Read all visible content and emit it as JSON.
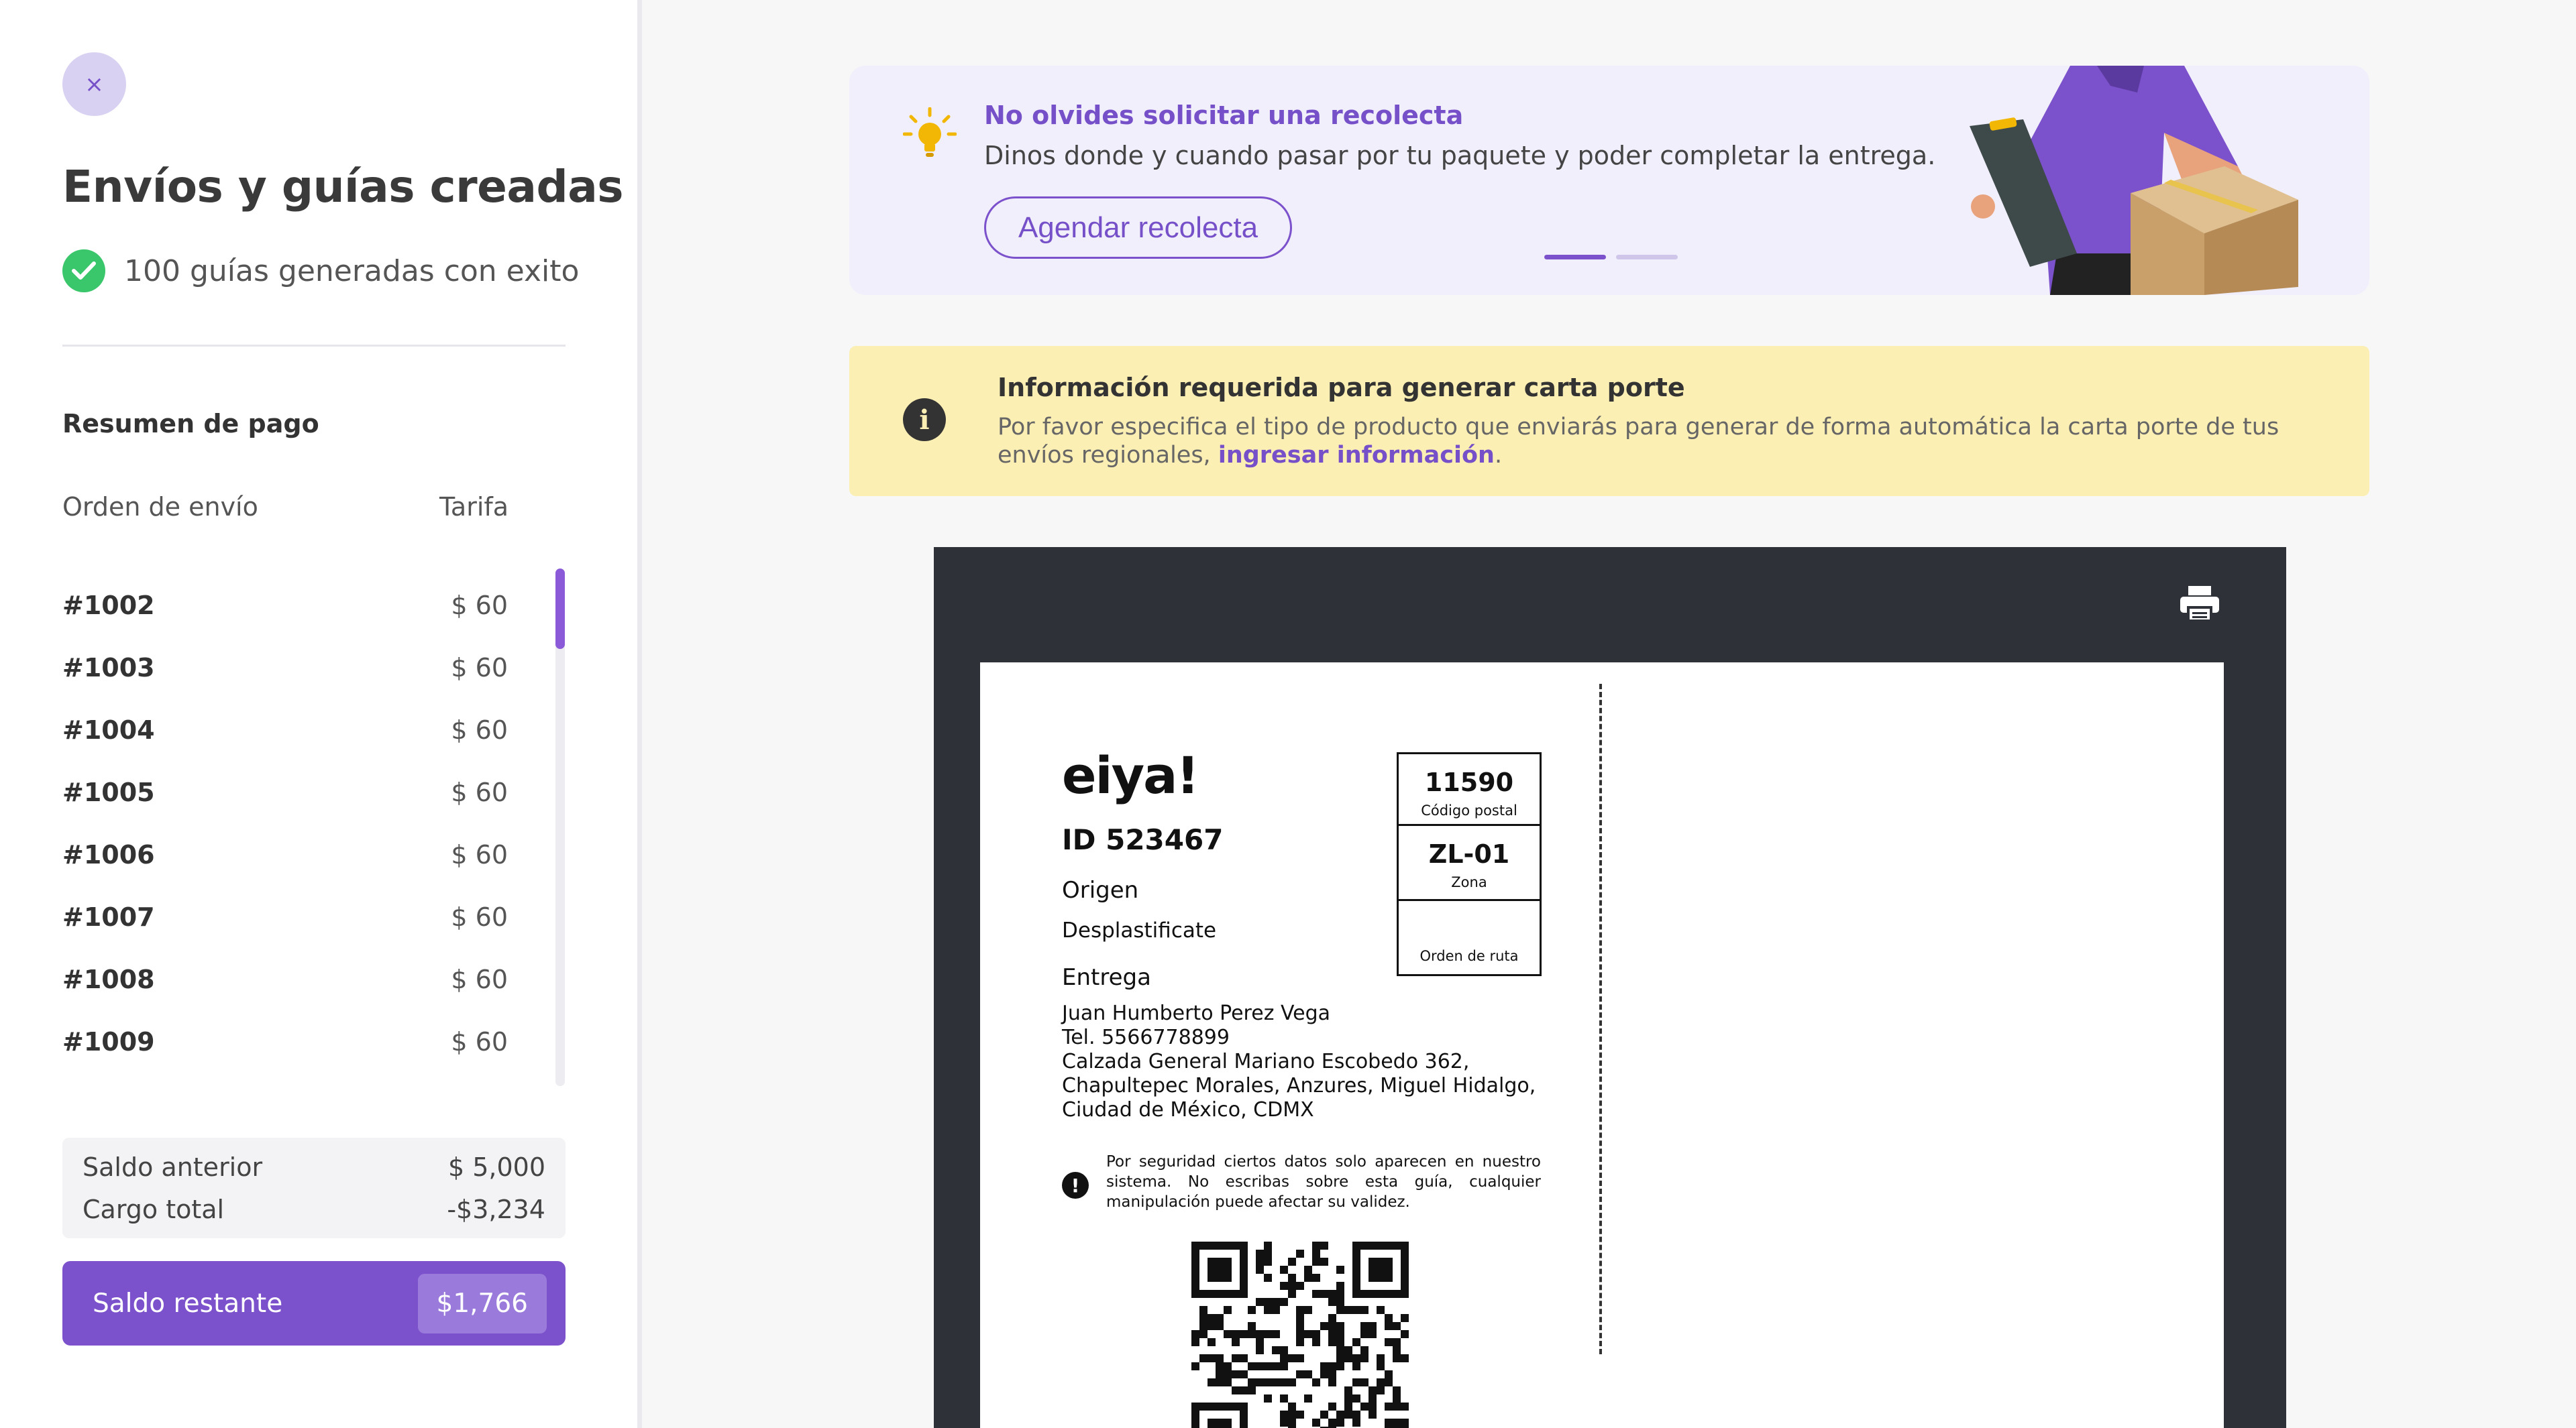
{
  "sidebar": {
    "close_symbol": "×",
    "title": "Envíos y guías creadas",
    "success_text": "100 guías generadas con exito",
    "summary_title": "Resumen de pago",
    "col_order": "Orden de envío",
    "col_rate": "Tarifa",
    "orders": [
      {
        "id": "#1002",
        "price": "$ 60"
      },
      {
        "id": "#1003",
        "price": "$ 60"
      },
      {
        "id": "#1004",
        "price": "$ 60"
      },
      {
        "id": "#1005",
        "price": "$ 60"
      },
      {
        "id": "#1006",
        "price": "$ 60"
      },
      {
        "id": "#1007",
        "price": "$ 60"
      },
      {
        "id": "#1008",
        "price": "$ 60"
      },
      {
        "id": "#1009",
        "price": "$ 60"
      }
    ],
    "previous_balance_label": "Saldo anterior",
    "previous_balance": "$ 5,000",
    "total_charge_label": "Cargo total",
    "total_charge": "-$3,234",
    "remaining_label": "Saldo restante",
    "remaining_amount": "$1,766"
  },
  "banner": {
    "title": "No olvides solicitar una recolecta",
    "text": "Dinos donde y cuando pasar por tu paquete y poder completar la entrega.",
    "button": "Agendar recolecta"
  },
  "warning": {
    "title": "Información requerida para generar carta porte",
    "text": "Por favor especifica el tipo de producto que enviarás para generar de forma automática la carta porte de tus envíos regionales,",
    "link": "ingresar información",
    "end": "."
  },
  "label": {
    "logo": "eiya!",
    "id": "ID 523467",
    "origin_heading": "Origen",
    "origin": "Desplastificate",
    "delivery_heading": "Entrega",
    "address_lines": [
      "Juan Humberto Perez Vega",
      "Tel. 5566778899",
      "Calzada General Mariano Escobedo 362,",
      "Chapultepec Morales, Anzures, Miguel Hidalgo,",
      "Ciudad de México, CDMX"
    ],
    "postal_code": "11590",
    "postal_code_caption": "Código postal",
    "zone": "ZL-01",
    "zone_caption": "Zona",
    "route_caption": "Orden de ruta",
    "security_note": "Por seguridad ciertos datos solo aparecen en nuestro sistema. No escribas sobre esta guía, cualquier manipulación puede afectar su validez."
  },
  "colors": {
    "accent": "#7c51cc",
    "success": "#3ac66a",
    "warning_bg": "#fcefb4",
    "label_frame": "#2e3137"
  },
  "icons": [
    "close-icon",
    "check-circle-icon",
    "lightbulb-icon",
    "info-icon",
    "printer-icon",
    "qr-code",
    "alert-icon"
  ]
}
